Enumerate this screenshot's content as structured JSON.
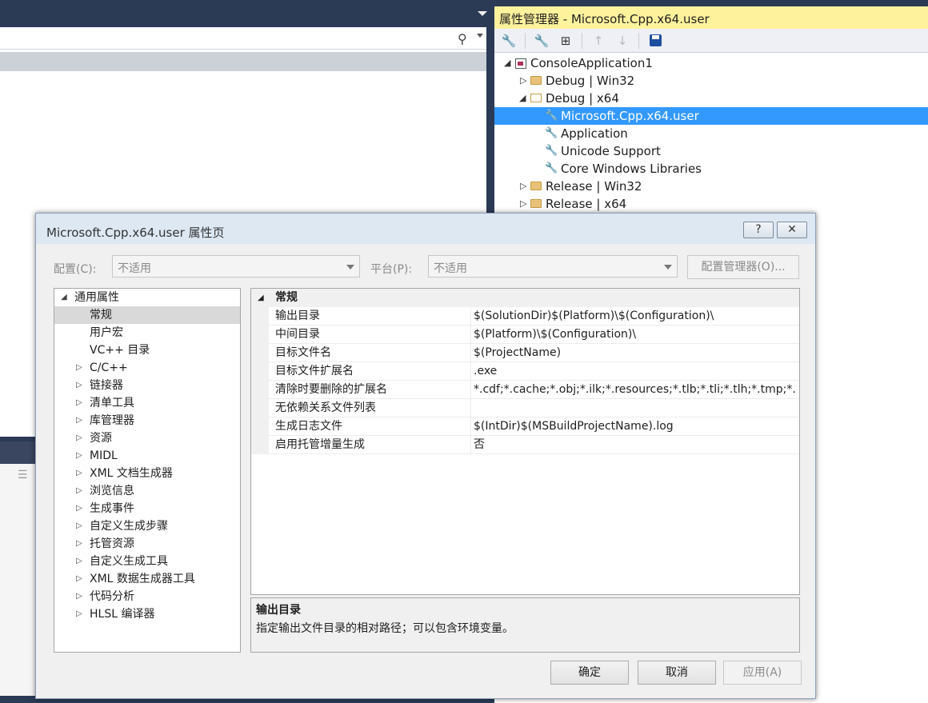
{
  "property_manager": {
    "title": "属性管理器 - Microsoft.Cpp.x64.user",
    "tree": {
      "project": "ConsoleApplication1",
      "configs": [
        {
          "label": "Debug | Win32"
        },
        {
          "label": "Debug | x64"
        },
        {
          "label": "Release | Win32"
        },
        {
          "label": "Release | x64"
        }
      ],
      "sheets": [
        {
          "label": "Microsoft.Cpp.x64.user"
        },
        {
          "label": "Application"
        },
        {
          "label": "Unicode Support"
        },
        {
          "label": "Core Windows Libraries"
        }
      ]
    }
  },
  "dialog": {
    "title": "Microsoft.Cpp.x64.user 属性页",
    "help_label": "?",
    "close_label": "✕",
    "config_label": "配置(C):",
    "config_value": "不适用",
    "platform_label": "平台(P):",
    "platform_value": "不适用",
    "config_manager_button": "配置管理器(O)...",
    "nav": {
      "root": "通用属性",
      "children": [
        "常规",
        "用户宏",
        "VC++ 目录"
      ],
      "groups": [
        "C/C++",
        "链接器",
        "清单工具",
        "库管理器",
        "资源",
        "MIDL",
        "XML 文档生成器",
        "浏览信息",
        "生成事件",
        "自定义生成步骤",
        "托管资源",
        "自定义生成工具",
        "XML 数据生成器工具",
        "代码分析",
        "HLSL 编译器"
      ]
    },
    "grid": {
      "section": "常规",
      "rows": [
        {
          "name": "输出目录",
          "value": "$(SolutionDir)$(Platform)\\$(Configuration)\\"
        },
        {
          "name": "中间目录",
          "value": "$(Platform)\\$(Configuration)\\"
        },
        {
          "name": "目标文件名",
          "value": "$(ProjectName)"
        },
        {
          "name": "目标文件扩展名",
          "value": ".exe"
        },
        {
          "name": "清除时要删除的扩展名",
          "value": "*.cdf;*.cache;*.obj;*.ilk;*.resources;*.tlb;*.tli;*.tlh;*.tmp;*."
        },
        {
          "name": "无依赖关系文件列表",
          "value": ""
        },
        {
          "name": "生成日志文件",
          "value": "$(IntDir)$(MSBuildProjectName).log"
        },
        {
          "name": "启用托管增量生成",
          "value": "否"
        }
      ]
    },
    "description": {
      "title": "输出目录",
      "text": "指定输出文件目录的相对路径；可以包含环境变量。"
    },
    "buttons": {
      "ok": "确定",
      "cancel": "取消",
      "apply": "应用(A)"
    }
  }
}
